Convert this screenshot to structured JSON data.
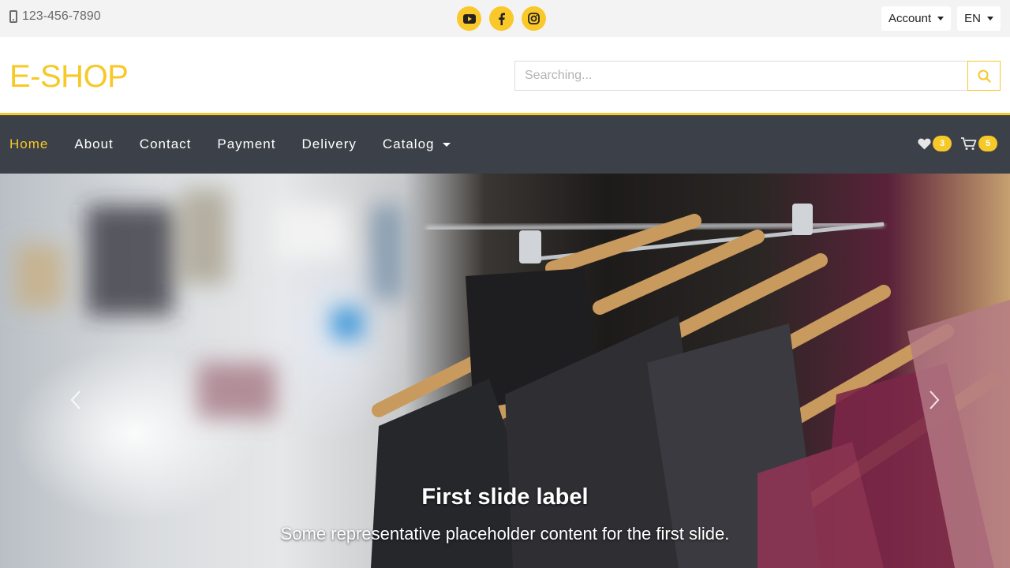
{
  "topbar": {
    "phone": "123-456-7890",
    "phone_icon": "phone-icon",
    "socials": [
      "youtube-icon",
      "facebook-icon",
      "instagram-icon"
    ],
    "account_label": "Account",
    "language_label": "EN"
  },
  "header": {
    "logo": "E-SHOP",
    "search_placeholder": "Searching...",
    "search_icon": "search-icon"
  },
  "nav": {
    "items": [
      {
        "label": "Home",
        "active": true
      },
      {
        "label": "About"
      },
      {
        "label": "Contact"
      },
      {
        "label": "Payment"
      },
      {
        "label": "Delivery"
      },
      {
        "label": "Catalog",
        "dropdown": true
      }
    ],
    "wishlist_count": "3",
    "cart_count": "5"
  },
  "hero": {
    "title": "First slide label",
    "text": "Some representative placeholder content for the first slide."
  },
  "colors": {
    "accent": "#f6c928",
    "nav_bg": "#3c4048",
    "topbar_bg": "#f3f3f3"
  }
}
